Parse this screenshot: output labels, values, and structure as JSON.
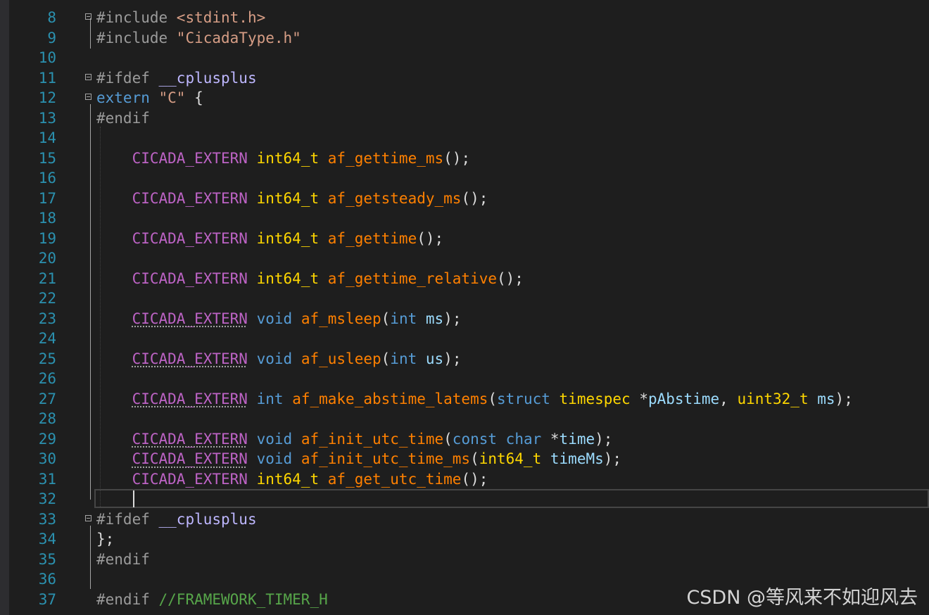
{
  "editor": {
    "lines": [
      {
        "num": "8",
        "fold": true,
        "tokens": [
          {
            "t": "#include ",
            "c": "pp"
          },
          {
            "t": "<stdint.h>",
            "c": "str"
          }
        ]
      },
      {
        "num": "9",
        "fold": false,
        "tokens": [
          {
            "t": "#include ",
            "c": "pp"
          },
          {
            "t": "\"CicadaType.h\"",
            "c": "str"
          }
        ]
      },
      {
        "num": "10",
        "fold": false,
        "tokens": []
      },
      {
        "num": "11",
        "fold": true,
        "tokens": [
          {
            "t": "#ifdef ",
            "c": "pp"
          },
          {
            "t": "__cplusplus",
            "c": "cpp"
          }
        ]
      },
      {
        "num": "12",
        "fold": true,
        "tokens": [
          {
            "t": "extern",
            "c": "kw"
          },
          {
            "t": " ",
            "c": ""
          },
          {
            "t": "\"C\"",
            "c": "str"
          },
          {
            "t": " {",
            "c": ""
          }
        ]
      },
      {
        "num": "13",
        "fold": false,
        "tokens": [
          {
            "t": "#endif",
            "c": "pp"
          }
        ]
      },
      {
        "num": "14",
        "fold": false,
        "tokens": []
      },
      {
        "num": "15",
        "fold": false,
        "tokens": [
          {
            "t": "    ",
            "c": ""
          },
          {
            "t": "CICADA_EXTERN",
            "c": "macro"
          },
          {
            "t": " ",
            "c": ""
          },
          {
            "t": "int64_t",
            "c": "type"
          },
          {
            "t": " ",
            "c": ""
          },
          {
            "t": "af_gettime_ms",
            "c": "fn"
          },
          {
            "t": "();",
            "c": ""
          }
        ]
      },
      {
        "num": "16",
        "fold": false,
        "tokens": []
      },
      {
        "num": "17",
        "fold": false,
        "tokens": [
          {
            "t": "    ",
            "c": ""
          },
          {
            "t": "CICADA_EXTERN",
            "c": "macro"
          },
          {
            "t": " ",
            "c": ""
          },
          {
            "t": "int64_t",
            "c": "type"
          },
          {
            "t": " ",
            "c": ""
          },
          {
            "t": "af_getsteady_ms",
            "c": "fn"
          },
          {
            "t": "();",
            "c": ""
          }
        ]
      },
      {
        "num": "18",
        "fold": false,
        "tokens": []
      },
      {
        "num": "19",
        "fold": false,
        "tokens": [
          {
            "t": "    ",
            "c": ""
          },
          {
            "t": "CICADA_EXTERN",
            "c": "macro"
          },
          {
            "t": " ",
            "c": ""
          },
          {
            "t": "int64_t",
            "c": "type"
          },
          {
            "t": " ",
            "c": ""
          },
          {
            "t": "af_gettime",
            "c": "fn"
          },
          {
            "t": "();",
            "c": ""
          }
        ]
      },
      {
        "num": "20",
        "fold": false,
        "tokens": []
      },
      {
        "num": "21",
        "fold": false,
        "tokens": [
          {
            "t": "    ",
            "c": ""
          },
          {
            "t": "CICADA_EXTERN",
            "c": "macro"
          },
          {
            "t": " ",
            "c": ""
          },
          {
            "t": "int64_t",
            "c": "type"
          },
          {
            "t": " ",
            "c": ""
          },
          {
            "t": "af_gettime_relative",
            "c": "fn"
          },
          {
            "t": "();",
            "c": ""
          }
        ]
      },
      {
        "num": "22",
        "fold": false,
        "tokens": []
      },
      {
        "num": "23",
        "fold": false,
        "tokens": [
          {
            "t": "    ",
            "c": ""
          },
          {
            "t": "CICADA_EXTERN",
            "c": "macro dotted"
          },
          {
            "t": " ",
            "c": ""
          },
          {
            "t": "void",
            "c": "kw"
          },
          {
            "t": " ",
            "c": ""
          },
          {
            "t": "af_msleep",
            "c": "fn"
          },
          {
            "t": "(",
            "c": ""
          },
          {
            "t": "int",
            "c": "kw"
          },
          {
            "t": " ",
            "c": ""
          },
          {
            "t": "ms",
            "c": "param"
          },
          {
            "t": ");",
            "c": ""
          }
        ]
      },
      {
        "num": "24",
        "fold": false,
        "tokens": []
      },
      {
        "num": "25",
        "fold": false,
        "tokens": [
          {
            "t": "    ",
            "c": ""
          },
          {
            "t": "CICADA_EXTERN",
            "c": "macro dotted"
          },
          {
            "t": " ",
            "c": ""
          },
          {
            "t": "void",
            "c": "kw"
          },
          {
            "t": " ",
            "c": ""
          },
          {
            "t": "af_usleep",
            "c": "fn"
          },
          {
            "t": "(",
            "c": ""
          },
          {
            "t": "int",
            "c": "kw"
          },
          {
            "t": " ",
            "c": ""
          },
          {
            "t": "us",
            "c": "param"
          },
          {
            "t": ");",
            "c": ""
          }
        ]
      },
      {
        "num": "26",
        "fold": false,
        "tokens": []
      },
      {
        "num": "27",
        "fold": false,
        "tokens": [
          {
            "t": "    ",
            "c": ""
          },
          {
            "t": "CICADA_EXTERN",
            "c": "macro dotted"
          },
          {
            "t": " ",
            "c": ""
          },
          {
            "t": "int",
            "c": "kw"
          },
          {
            "t": " ",
            "c": ""
          },
          {
            "t": "af_make_abstime_latems",
            "c": "fn"
          },
          {
            "t": "(",
            "c": ""
          },
          {
            "t": "struct",
            "c": "kw"
          },
          {
            "t": " ",
            "c": ""
          },
          {
            "t": "timespec",
            "c": "type"
          },
          {
            "t": " *",
            "c": ""
          },
          {
            "t": "pAbstime",
            "c": "param"
          },
          {
            "t": ", ",
            "c": ""
          },
          {
            "t": "uint32_t",
            "c": "type"
          },
          {
            "t": " ",
            "c": ""
          },
          {
            "t": "ms",
            "c": "param"
          },
          {
            "t": ");",
            "c": ""
          }
        ]
      },
      {
        "num": "28",
        "fold": false,
        "tokens": []
      },
      {
        "num": "29",
        "fold": false,
        "tokens": [
          {
            "t": "    ",
            "c": ""
          },
          {
            "t": "CICADA_EXTERN",
            "c": "macro dotted"
          },
          {
            "t": " ",
            "c": ""
          },
          {
            "t": "void",
            "c": "kw"
          },
          {
            "t": " ",
            "c": ""
          },
          {
            "t": "af_init_utc_time",
            "c": "fn"
          },
          {
            "t": "(",
            "c": ""
          },
          {
            "t": "const",
            "c": "kw"
          },
          {
            "t": " ",
            "c": ""
          },
          {
            "t": "char",
            "c": "kw"
          },
          {
            "t": " *",
            "c": ""
          },
          {
            "t": "time",
            "c": "param"
          },
          {
            "t": ");",
            "c": ""
          }
        ]
      },
      {
        "num": "30",
        "fold": false,
        "tokens": [
          {
            "t": "    ",
            "c": ""
          },
          {
            "t": "CICADA_EXTERN",
            "c": "macro dotted"
          },
          {
            "t": " ",
            "c": ""
          },
          {
            "t": "void",
            "c": "kw"
          },
          {
            "t": " ",
            "c": ""
          },
          {
            "t": "af_init_utc_time_ms",
            "c": "fn"
          },
          {
            "t": "(",
            "c": ""
          },
          {
            "t": "int64_t",
            "c": "type"
          },
          {
            "t": " ",
            "c": ""
          },
          {
            "t": "timeMs",
            "c": "param"
          },
          {
            "t": ");",
            "c": ""
          }
        ]
      },
      {
        "num": "31",
        "fold": false,
        "tokens": [
          {
            "t": "    ",
            "c": ""
          },
          {
            "t": "CICADA_EXTERN",
            "c": "macro"
          },
          {
            "t": " ",
            "c": ""
          },
          {
            "t": "int64_t",
            "c": "type"
          },
          {
            "t": " ",
            "c": ""
          },
          {
            "t": "af_get_utc_time",
            "c": "fn"
          },
          {
            "t": "();",
            "c": ""
          }
        ]
      },
      {
        "num": "32",
        "fold": false,
        "tokens": []
      },
      {
        "num": "33",
        "fold": true,
        "tokens": [
          {
            "t": "#ifdef ",
            "c": "pp"
          },
          {
            "t": "__cplusplus",
            "c": "cpp"
          }
        ]
      },
      {
        "num": "34",
        "fold": false,
        "tokens": [
          {
            "t": "};",
            "c": ""
          }
        ]
      },
      {
        "num": "35",
        "fold": false,
        "tokens": [
          {
            "t": "#endif",
            "c": "pp"
          }
        ]
      },
      {
        "num": "36",
        "fold": false,
        "tokens": []
      },
      {
        "num": "37",
        "fold": false,
        "tokens": [
          {
            "t": "#endif ",
            "c": "pp"
          },
          {
            "t": "//FRAMEWORK_TIMER_H",
            "c": "cmt"
          }
        ]
      }
    ]
  },
  "watermark": "CSDN @等风来不如迎风去"
}
